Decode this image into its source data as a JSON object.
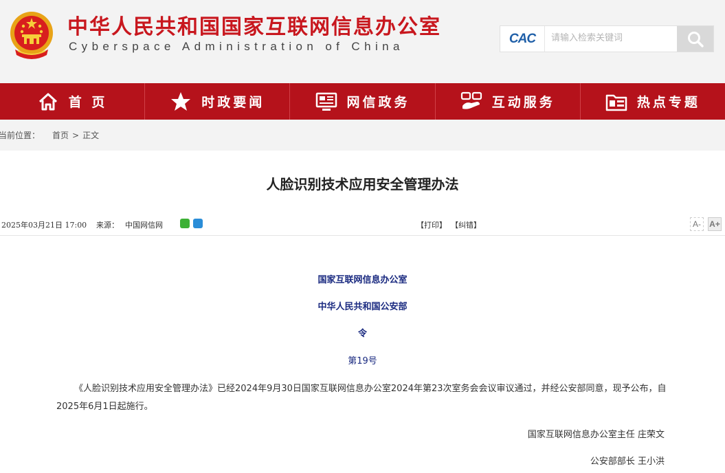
{
  "header": {
    "site_name_cn": "中华人民共和国国家互联网信息办公室",
    "site_name_en": "Cyberspace Administration of China",
    "search_logo": "CAC",
    "search_placeholder": "请输入检索关键词"
  },
  "nav": {
    "items": [
      {
        "label": "首 页",
        "icon": "home-icon"
      },
      {
        "label": "时政要闻",
        "icon": "star-icon"
      },
      {
        "label": "网信政务",
        "icon": "monitor-icon"
      },
      {
        "label": "互动服务",
        "icon": "handshake-icon"
      },
      {
        "label": "热点专题",
        "icon": "folder-icon"
      }
    ]
  },
  "breadcrumb": {
    "label": "当前位置：",
    "home": "首页",
    "separator": ">",
    "current": "正文"
  },
  "article": {
    "title": "人脸识别技术应用安全管理办法",
    "date": "2025年03月21日 17:00",
    "source_label": "来源：",
    "source": "中国网信网",
    "print": "【打印】",
    "correct": "【纠错】",
    "font_small": "A-",
    "font_large": "A+",
    "issuer_1": "国家互联网信息办公室",
    "issuer_2": "中华人民共和国公安部",
    "order_title": "令",
    "order_no": "第19号",
    "paragraph": "《人脸识别技术应用安全管理办法》已经2024年9月30日国家互联网信息办公室2024年第23次室务会会议审议通过，并经公安部同意，现予公布，自2025年6月1日起施行。",
    "signer_1": "国家互联网信息办公室主任 庄荣文",
    "signer_2": "公安部部长 王小洪"
  },
  "colors": {
    "brand_red": "#b5121b",
    "title_red": "#c8171e",
    "issuer_blue": "#1a2a80"
  }
}
